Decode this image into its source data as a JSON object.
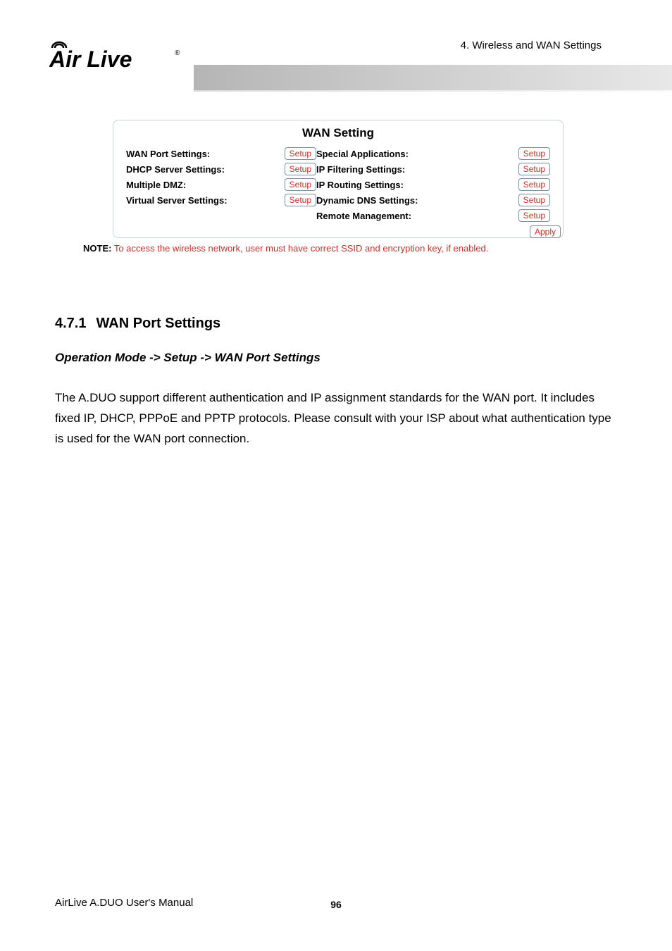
{
  "header": {
    "chapter": "4. Wireless and WAN Settings",
    "logo_text": "Air Live"
  },
  "panel": {
    "title": "WAN Setting",
    "left": [
      {
        "label": "WAN Port Settings:",
        "btn": "Setup"
      },
      {
        "label": "DHCP Server Settings:",
        "btn": "Setup"
      },
      {
        "label": "Multiple DMZ:",
        "btn": "Setup"
      },
      {
        "label": "Virtual Server Settings:",
        "btn": "Setup"
      }
    ],
    "right": [
      {
        "label": "Special Applications:",
        "btn": "Setup"
      },
      {
        "label": "IP Filtering Settings:",
        "btn": "Setup"
      },
      {
        "label": "IP Routing Settings:",
        "btn": "Setup"
      },
      {
        "label": "Dynamic DNS Settings:",
        "btn": "Setup"
      },
      {
        "label": "Remote Management:",
        "btn": "Setup"
      }
    ],
    "apply": "Apply"
  },
  "note": {
    "label": "NOTE:",
    "text": " To access the wireless network, user must have correct SSID and encryption key, if enabled."
  },
  "section": {
    "number": "4.7.1",
    "title": "WAN Port Settings",
    "operation": "Operation Mode -> Setup -> WAN Port Settings",
    "body": "The A.DUO support different authentication and IP assignment standards for the WAN port. It includes fixed IP, DHCP, PPPoE and PPTP protocols. Please consult with your ISP about what authentication type is used for the WAN port connection."
  },
  "footer": {
    "manual": "AirLive A.DUO User's Manual",
    "page": "96"
  }
}
